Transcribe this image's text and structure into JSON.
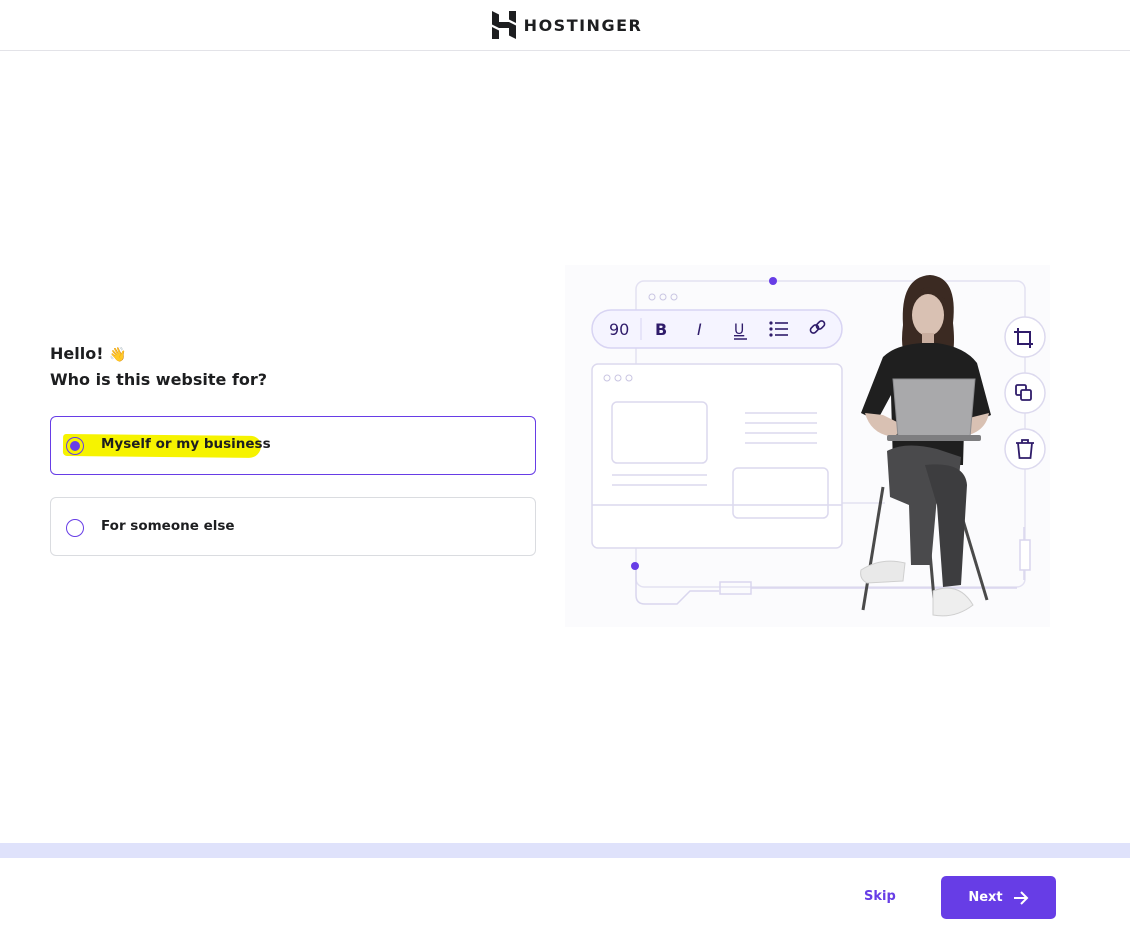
{
  "header": {
    "logo_text": "HOSTINGER"
  },
  "main": {
    "greeting": "Hello!",
    "greeting_emoji": "👋",
    "question": "Who is this website for?",
    "options": [
      {
        "label": "Myself or my business",
        "selected": true
      },
      {
        "label": "For someone else",
        "selected": false
      }
    ]
  },
  "illustration": {
    "toolbar": {
      "font_size_value": "90",
      "bold_label": "B",
      "italic_label": "I",
      "underline_label": "U"
    },
    "side_tools": [
      "crop-icon",
      "copy-icon",
      "trash-icon"
    ]
  },
  "footer": {
    "skip_label": "Skip",
    "next_label": "Next"
  },
  "colors": {
    "accent": "#673de6",
    "highlight": "#f6f300",
    "progress_track": "#dfe2fb"
  }
}
